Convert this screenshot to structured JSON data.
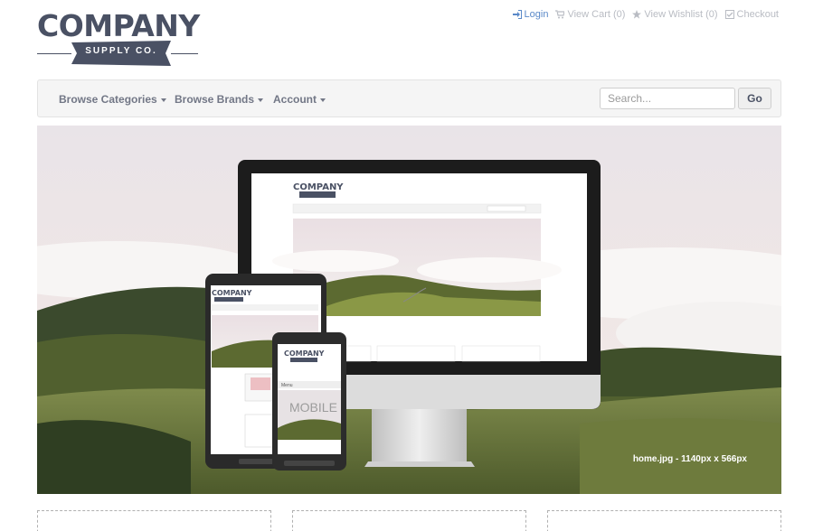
{
  "logo": {
    "word": "COMPANY",
    "tagline": "SUPPLY CO."
  },
  "top_links": [
    {
      "label": "Login",
      "icon": "login-icon"
    },
    {
      "label": "View Cart (0)",
      "icon": "cart-icon"
    },
    {
      "label": "View Wishlist (0)",
      "icon": "star-icon"
    },
    {
      "label": "Checkout",
      "icon": "checkout-icon"
    }
  ],
  "nav": {
    "items": [
      {
        "label": "Browse Categories"
      },
      {
        "label": "Browse Brands"
      },
      {
        "label": "Account"
      }
    ],
    "search_placeholder": "Search...",
    "go_label": "Go"
  },
  "hero": {
    "caption": "home.jpg - 1140px x 566px",
    "screen_mobile_text": "MOBILE",
    "screen_menu_text": "Menu"
  },
  "colors": {
    "brand": "#4a5164",
    "link": "#5a89c8",
    "muted_link": "#b9bcc3",
    "navbar_bg": "#f5f5f5"
  }
}
